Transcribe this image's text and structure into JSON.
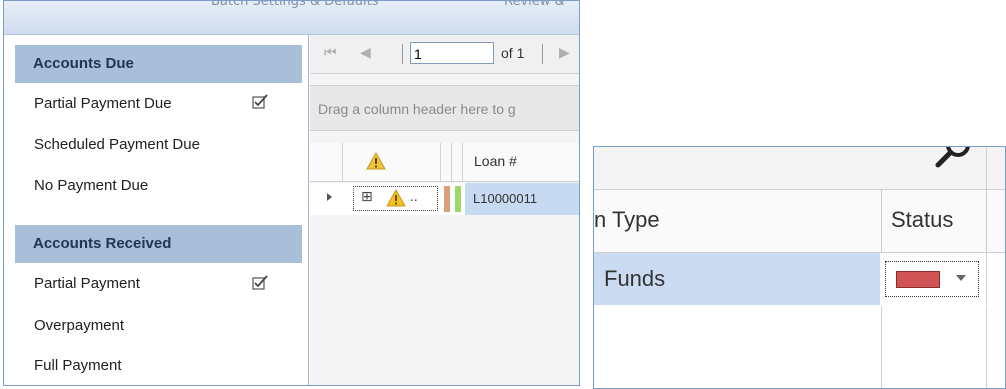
{
  "left": {
    "tabs": [
      "Batch Settings & Defaults",
      "Review &"
    ],
    "accounts_due": {
      "title": "Accounts Due",
      "items": [
        {
          "label": "Partial Payment Due",
          "checked": true
        },
        {
          "label": "Scheduled Payment Due",
          "checked": false
        },
        {
          "label": "No Payment Due",
          "checked": false
        }
      ]
    },
    "accounts_received": {
      "title": "Accounts Received",
      "items": [
        {
          "label": "Partial Payment",
          "checked": true
        },
        {
          "label": "Overpayment",
          "checked": false
        },
        {
          "label": "Full Payment",
          "checked": false
        }
      ]
    },
    "pager": {
      "page": "1",
      "of_pages": "of 1"
    },
    "group_hint": "Drag a column header here to g",
    "columns": {
      "loan": "Loan #"
    },
    "row": {
      "expand": "⊞",
      "dots": "..",
      "loan": "L10000011"
    }
  },
  "right": {
    "columns": {
      "type": "n Type",
      "status": "Status"
    },
    "row": {
      "type": "Funds"
    },
    "status_color": "#d05454"
  }
}
